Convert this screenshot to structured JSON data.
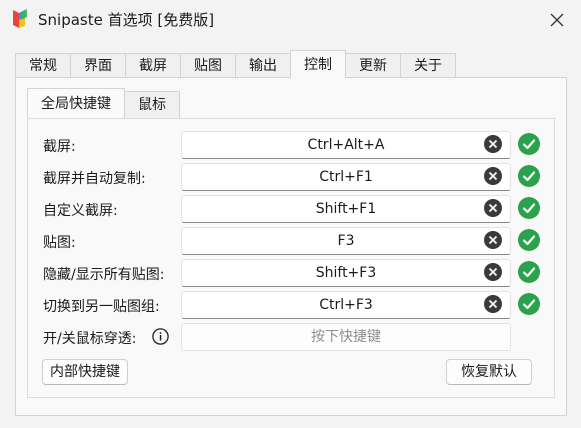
{
  "window": {
    "title": "Snipaste 首选项 [免费版]"
  },
  "tabs": [
    {
      "label": "常规"
    },
    {
      "label": "界面"
    },
    {
      "label": "截屏"
    },
    {
      "label": "贴图"
    },
    {
      "label": "输出"
    },
    {
      "label": "控制",
      "active": true
    },
    {
      "label": "更新"
    },
    {
      "label": "关于"
    }
  ],
  "subtabs": [
    {
      "label": "全局快捷键",
      "active": true
    },
    {
      "label": "鼠标"
    }
  ],
  "hotkeys": [
    {
      "label": "截屏:",
      "value": "Ctrl+Alt+A",
      "status": "ok"
    },
    {
      "label": "截屏并自动复制:",
      "value": "Ctrl+F1",
      "status": "ok"
    },
    {
      "label": "自定义截屏:",
      "value": "Shift+F1",
      "status": "ok"
    },
    {
      "label": "贴图:",
      "value": "F3",
      "status": "ok"
    },
    {
      "label": "隐藏/显示所有贴图:",
      "value": "Shift+F3",
      "status": "ok"
    },
    {
      "label": "切换到另一贴图组:",
      "value": "Ctrl+F3",
      "status": "ok"
    }
  ],
  "mouse_passthrough": {
    "label": "开/关鼠标穿透:",
    "placeholder": "按下快捷键"
  },
  "buttons": {
    "internal": "内部快捷键",
    "restore": "恢复默认"
  },
  "colors": {
    "ok": "#2aa14c",
    "clear": "#3a3a3a"
  }
}
